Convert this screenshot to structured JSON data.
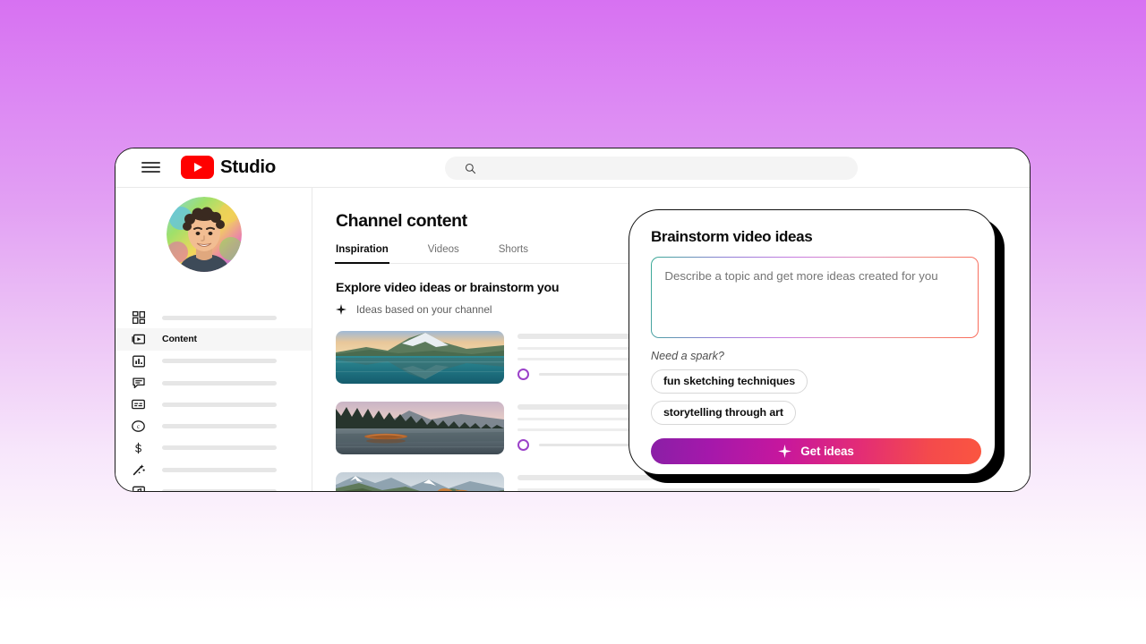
{
  "background": {
    "gradient_top": "#d771f2",
    "gradient_bottom": "#ffffff"
  },
  "app": {
    "brand_name": "Studio",
    "logo_color": "#ff0000",
    "menu_icon": "hamburger-menu-icon",
    "search": {
      "icon": "search-icon",
      "value": "",
      "placeholder": ""
    }
  },
  "sidebar": {
    "avatar_alt": "channel-avatar",
    "items": [
      {
        "icon": "dashboard-grid-icon",
        "label": "",
        "active": false
      },
      {
        "icon": "content-video-icon",
        "label": "Content",
        "active": true
      },
      {
        "icon": "analytics-bar-chart-icon",
        "label": "",
        "active": false
      },
      {
        "icon": "comments-speech-bubble-icon",
        "label": "",
        "active": false
      },
      {
        "icon": "subtitles-icon",
        "label": "",
        "active": false
      },
      {
        "icon": "copyright-icon",
        "label": "",
        "active": false
      },
      {
        "icon": "earn-dollar-icon",
        "label": "",
        "active": false
      },
      {
        "icon": "customization-wand-icon",
        "label": "",
        "active": false
      },
      {
        "icon": "audio-library-icon",
        "label": "",
        "active": false
      }
    ]
  },
  "main": {
    "page_title": "Channel content",
    "tabs": [
      {
        "label": "Inspiration",
        "active": true
      },
      {
        "label": "Videos",
        "active": false
      },
      {
        "label": "Shorts",
        "active": false
      }
    ],
    "explore_heading": "Explore video ideas or brainstorm you",
    "subline": {
      "icon": "sparkle-icon",
      "text": "Ideas based on your channel"
    },
    "idea_rows": [
      {
        "thumbnail": "mountain-peak-lake-reflection-thumbnail",
        "ring_icon": "loading-ring-icon"
      },
      {
        "thumbnail": "wooden-boat-misty-lake-thumbnail",
        "ring_icon": "loading-ring-icon"
      },
      {
        "thumbnail": "person-red-jacket-mountain-view-thumbnail",
        "ring_icon": "loading-ring-icon"
      }
    ]
  },
  "overlay": {
    "title": "Brainstorm video ideas",
    "textarea": {
      "value": "",
      "placeholder": "Describe a topic and get more ideas created for you"
    },
    "spark_label": "Need a spark?",
    "chips": [
      "fun sketching techniques",
      "storytelling through art"
    ],
    "cta": {
      "icon": "sparkle-icon",
      "label": "Get ideas",
      "gradient_start": "#8a1fa6",
      "gradient_mid": "#c7179d",
      "gradient_end": "#fb5640"
    },
    "textarea_border_gradient": {
      "start": "#3aab96",
      "mid": "#c77ce0",
      "end": "#fa6b5a"
    }
  }
}
